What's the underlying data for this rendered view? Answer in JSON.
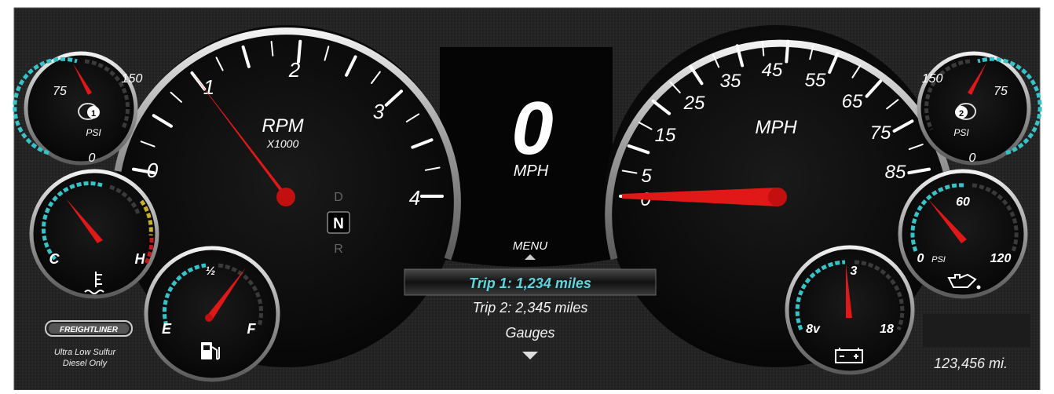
{
  "colors": {
    "accent_teal": "#36c3c8",
    "needle_red": "#e01818",
    "bezel": "#cfcfcf"
  },
  "tach": {
    "unit": "RPM",
    "multiplier": "X1000",
    "ticks": [
      "0",
      "1",
      "2",
      "3",
      "4"
    ],
    "needle_value": 1.0
  },
  "gear": {
    "options": [
      "D",
      "N",
      "R"
    ],
    "selected": "N"
  },
  "digital_speed": {
    "value": "0",
    "unit": "MPH"
  },
  "speedo": {
    "unit": "MPH",
    "ticks": [
      "0",
      "5",
      "15",
      "25",
      "35",
      "45",
      "55",
      "65",
      "75",
      "85"
    ],
    "needle_value": 0
  },
  "air1": {
    "max": "150",
    "mid": "75",
    "min": "0",
    "unit": "PSI",
    "number": "1",
    "icon": "air-brake-icon"
  },
  "air2": {
    "max": "150",
    "mid": "75",
    "min": "0",
    "unit": "PSI",
    "number": "2",
    "icon": "air-brake-icon"
  },
  "coolant": {
    "cold": "C",
    "hot": "H",
    "icon": "coolant-temperature-icon"
  },
  "fuel": {
    "empty": "E",
    "half": "½",
    "full": "F",
    "icon": "fuel-pump-icon"
  },
  "oil": {
    "min": "0",
    "unit": "PSI",
    "mid": "60",
    "max": "120",
    "icon": "oil-can-icon"
  },
  "battery": {
    "min": "8v",
    "mid": "3",
    "max": "18",
    "icon": "battery-icon"
  },
  "menu": {
    "title": "MENU",
    "items": [
      {
        "label": "Trip 1:  1,234 miles",
        "selected": true
      },
      {
        "label": "Trip 2:  2,345 miles",
        "selected": false
      },
      {
        "label": "Gauges",
        "selected": false
      }
    ]
  },
  "brand": {
    "logo": "FREIGHTLINER",
    "note_line1": "Ultra Low Sulfur",
    "note_line2": "Diesel Only"
  },
  "odometer": "123,456 mi."
}
